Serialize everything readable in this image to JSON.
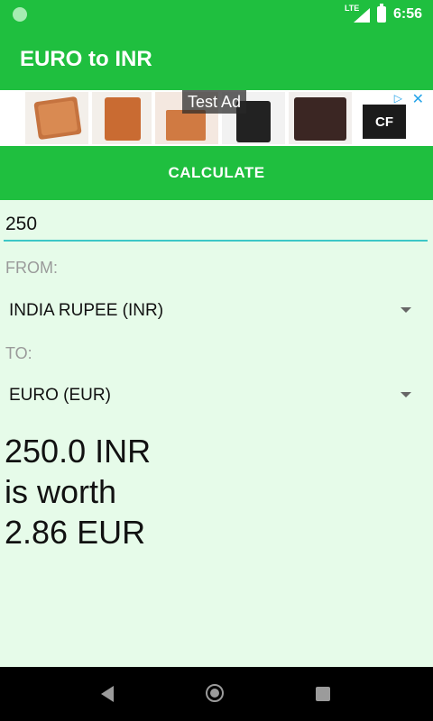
{
  "status_bar": {
    "time": "6:56",
    "network": "LTE"
  },
  "app_bar": {
    "title": "EURO to INR"
  },
  "ad": {
    "label": "Test Ad",
    "brand": "CF",
    "choices_icon": "ad-choices-icon",
    "close_glyph": "✕"
  },
  "calculate_button": {
    "label": "CALCULATE"
  },
  "amount_input": {
    "value": "250"
  },
  "from": {
    "label": "FROM:",
    "selected": "INDIA RUPEE (INR)"
  },
  "to": {
    "label": "TO:",
    "selected": "EURO (EUR)"
  },
  "result": {
    "line1": "250.0 INR",
    "line2": "is worth",
    "line3": "2.86 EUR"
  },
  "colors": {
    "primary": "#1fbf3f",
    "background": "#e6fbe9",
    "accent": "#3cc7c7"
  }
}
